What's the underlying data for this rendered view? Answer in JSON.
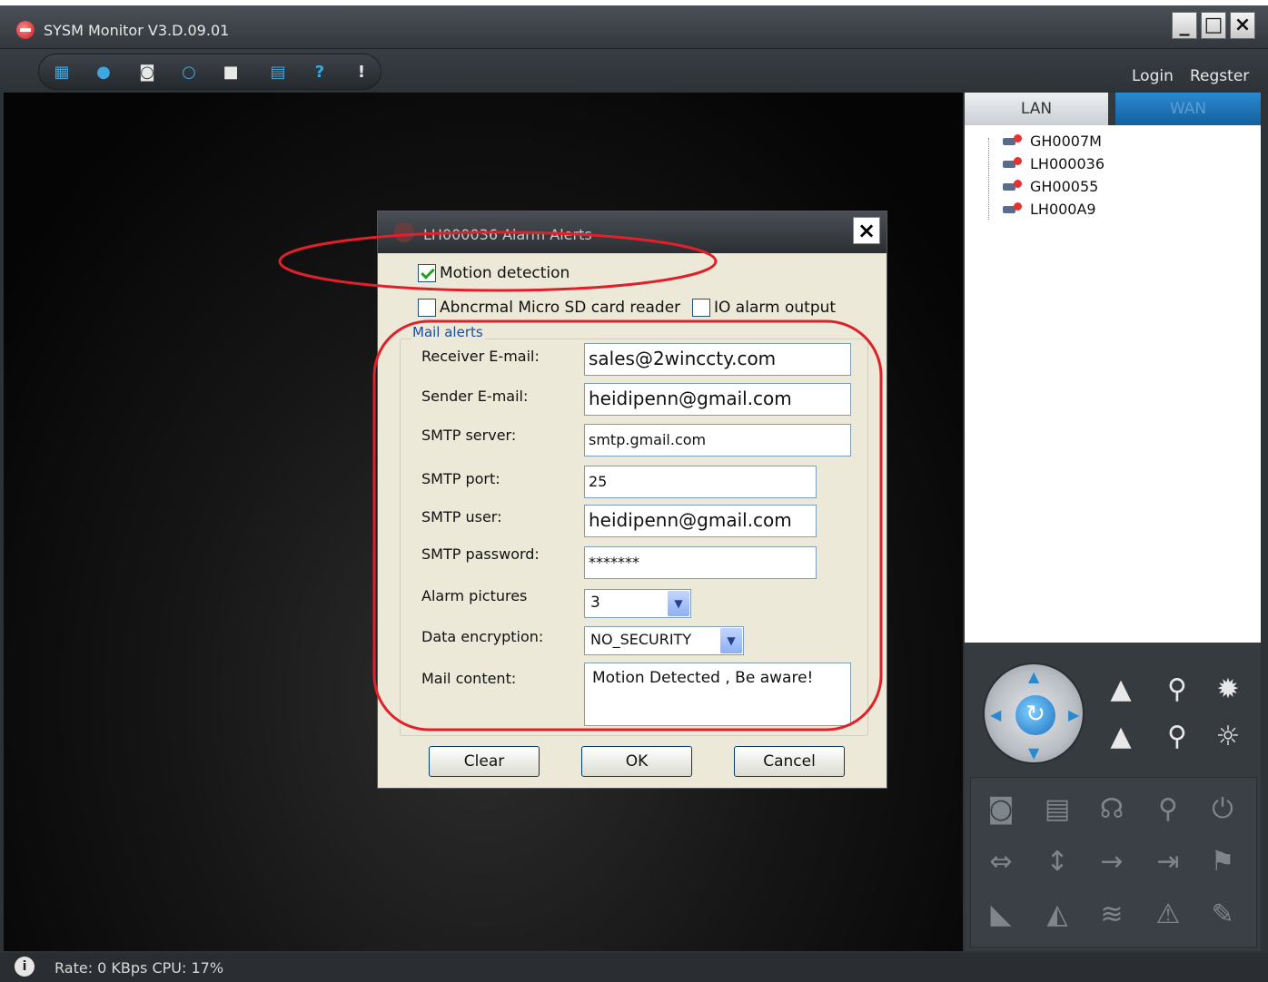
{
  "window": {
    "title": "SYSM Monitor  V3.D.09.01",
    "controls": [
      "_",
      "□",
      "×"
    ]
  },
  "toolbar": {
    "icons": [
      "layout-icon",
      "record-icon",
      "snapshot-icon",
      "search-icon",
      "lock-icon",
      "save-icon",
      "help-icon",
      "alert-icon"
    ],
    "login_label": "Login",
    "register_label": "Regster"
  },
  "sidebar": {
    "tabs": [
      {
        "label": "LAN",
        "active": true
      },
      {
        "label": "WAN",
        "active": false
      }
    ],
    "devices": [
      "GH0007M",
      "LH000036",
      "GH00055",
      "LH000A9"
    ]
  },
  "dialog": {
    "title": "LH000036 Alarm Alerts",
    "close_label": "×",
    "motion_detection": {
      "label": "Motion detection",
      "checked": true
    },
    "abnormal_sd": {
      "label": "Abncrmal Micro SD card reader",
      "checked": false
    },
    "io_alarm": {
      "label": "IO alarm output",
      "checked": false
    },
    "mail_alerts_label": "Mail alerts",
    "fields": {
      "receiver_email": {
        "label": "Receiver E-mail:",
        "value": "sales@2winccty.com"
      },
      "sender_email": {
        "label": "Sender E-mail:",
        "value": "heidipenn@gmail.com"
      },
      "smtp_server": {
        "label": "SMTP server:",
        "value": "smtp.gmail.com"
      },
      "smtp_port": {
        "label": "SMTP port:",
        "value": "25"
      },
      "smtp_user": {
        "label": "SMTP user:",
        "value": "heidipenn@gmail.com"
      },
      "smtp_password": {
        "label": "SMTP password:",
        "value": "*******"
      },
      "alarm_pictures": {
        "label": "Alarm pictures",
        "value": "3"
      },
      "data_encryption": {
        "label": "Data encryption:",
        "value": "NO_SECURITY"
      },
      "mail_content": {
        "label": "Mail content:",
        "value": "Motion Detected , Be aware!"
      }
    },
    "buttons": {
      "clear": "Clear",
      "ok": "OK",
      "cancel": "Cancel"
    }
  },
  "status": {
    "icon": "info-icon",
    "text": "Rate: 0 KBps  CPU:  17%"
  },
  "colors": {
    "annotation": "#e0202a",
    "accent": "#2a8ad0"
  }
}
